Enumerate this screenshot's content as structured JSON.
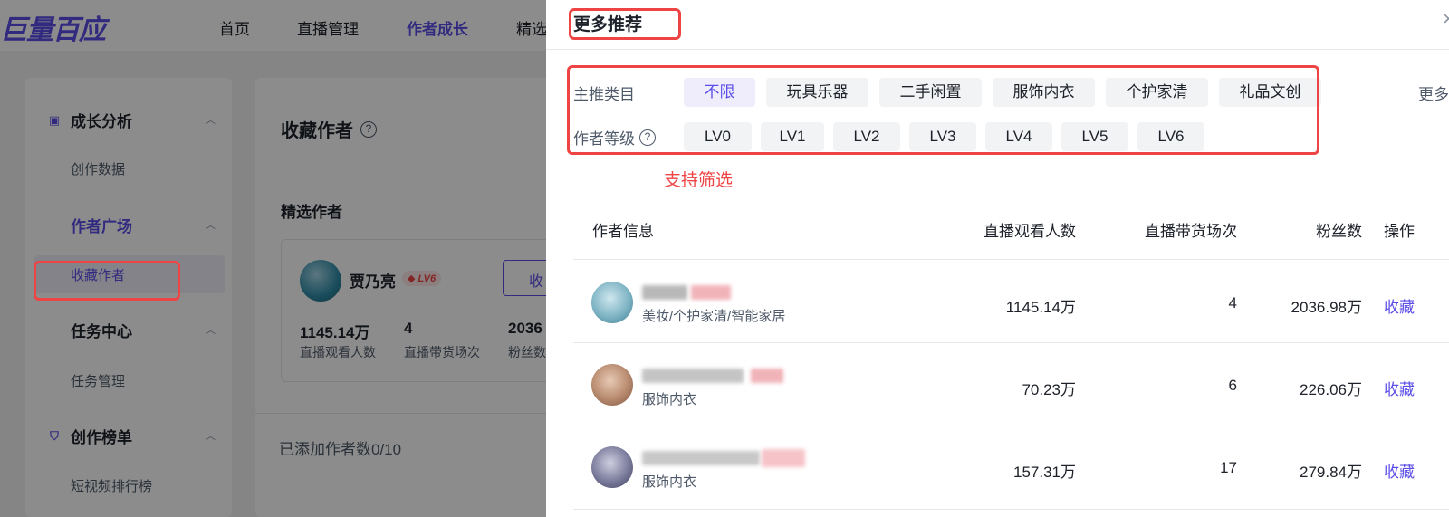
{
  "app": {
    "logo": "巨量百应",
    "topnav": [
      "首页",
      "直播管理",
      "作者成长",
      "精选"
    ]
  },
  "sidebar": {
    "groups": [
      {
        "label": "成长分析",
        "items": [
          "创作数据"
        ]
      },
      {
        "label": "作者广场",
        "items": [
          "收藏作者"
        ]
      },
      {
        "label": "任务中心",
        "items": [
          "任务管理"
        ]
      },
      {
        "label": "创作榜单",
        "items": [
          "短视频排行榜"
        ]
      }
    ]
  },
  "main": {
    "title": "收藏作者",
    "section": "精选作者",
    "card": {
      "name": "贾乃亮",
      "level": "LV6",
      "button": "收",
      "stats": [
        {
          "value": "1145.14万",
          "label": "直播观看人数"
        },
        {
          "value": "4",
          "label": "直播带货场次"
        },
        {
          "value": "2036",
          "label": "粉丝数"
        }
      ]
    },
    "added_count": "已添加作者数0/10"
  },
  "drawer": {
    "title": "更多推荐",
    "close": "×",
    "filters": {
      "category_label": "主推类目",
      "categories": [
        "不限",
        "玩具乐器",
        "二手闲置",
        "服饰内衣",
        "个护家清",
        "礼品文创"
      ],
      "more": "更多",
      "level_label": "作者等级",
      "levels": [
        "LV0",
        "LV1",
        "LV2",
        "LV3",
        "LV4",
        "LV5",
        "LV6"
      ]
    },
    "annotation": "支持筛选",
    "table": {
      "headers": [
        "作者信息",
        "直播观看人数",
        "直播带货场次",
        "粉丝数",
        "操作"
      ],
      "rows": [
        {
          "category": "美妆/个护家清/智能家居",
          "views": "1145.14万",
          "sessions": "4",
          "fans": "2036.98万",
          "action": "收藏"
        },
        {
          "category": "服饰内衣",
          "views": "70.23万",
          "sessions": "6",
          "fans": "226.06万",
          "action": "收藏"
        },
        {
          "category": "服饰内衣",
          "views": "157.31万",
          "sessions": "17",
          "fans": "279.84万",
          "action": "收藏"
        }
      ]
    }
  },
  "colors": {
    "accent": "#5b4ee8",
    "annotation_red": "#ef4444"
  }
}
